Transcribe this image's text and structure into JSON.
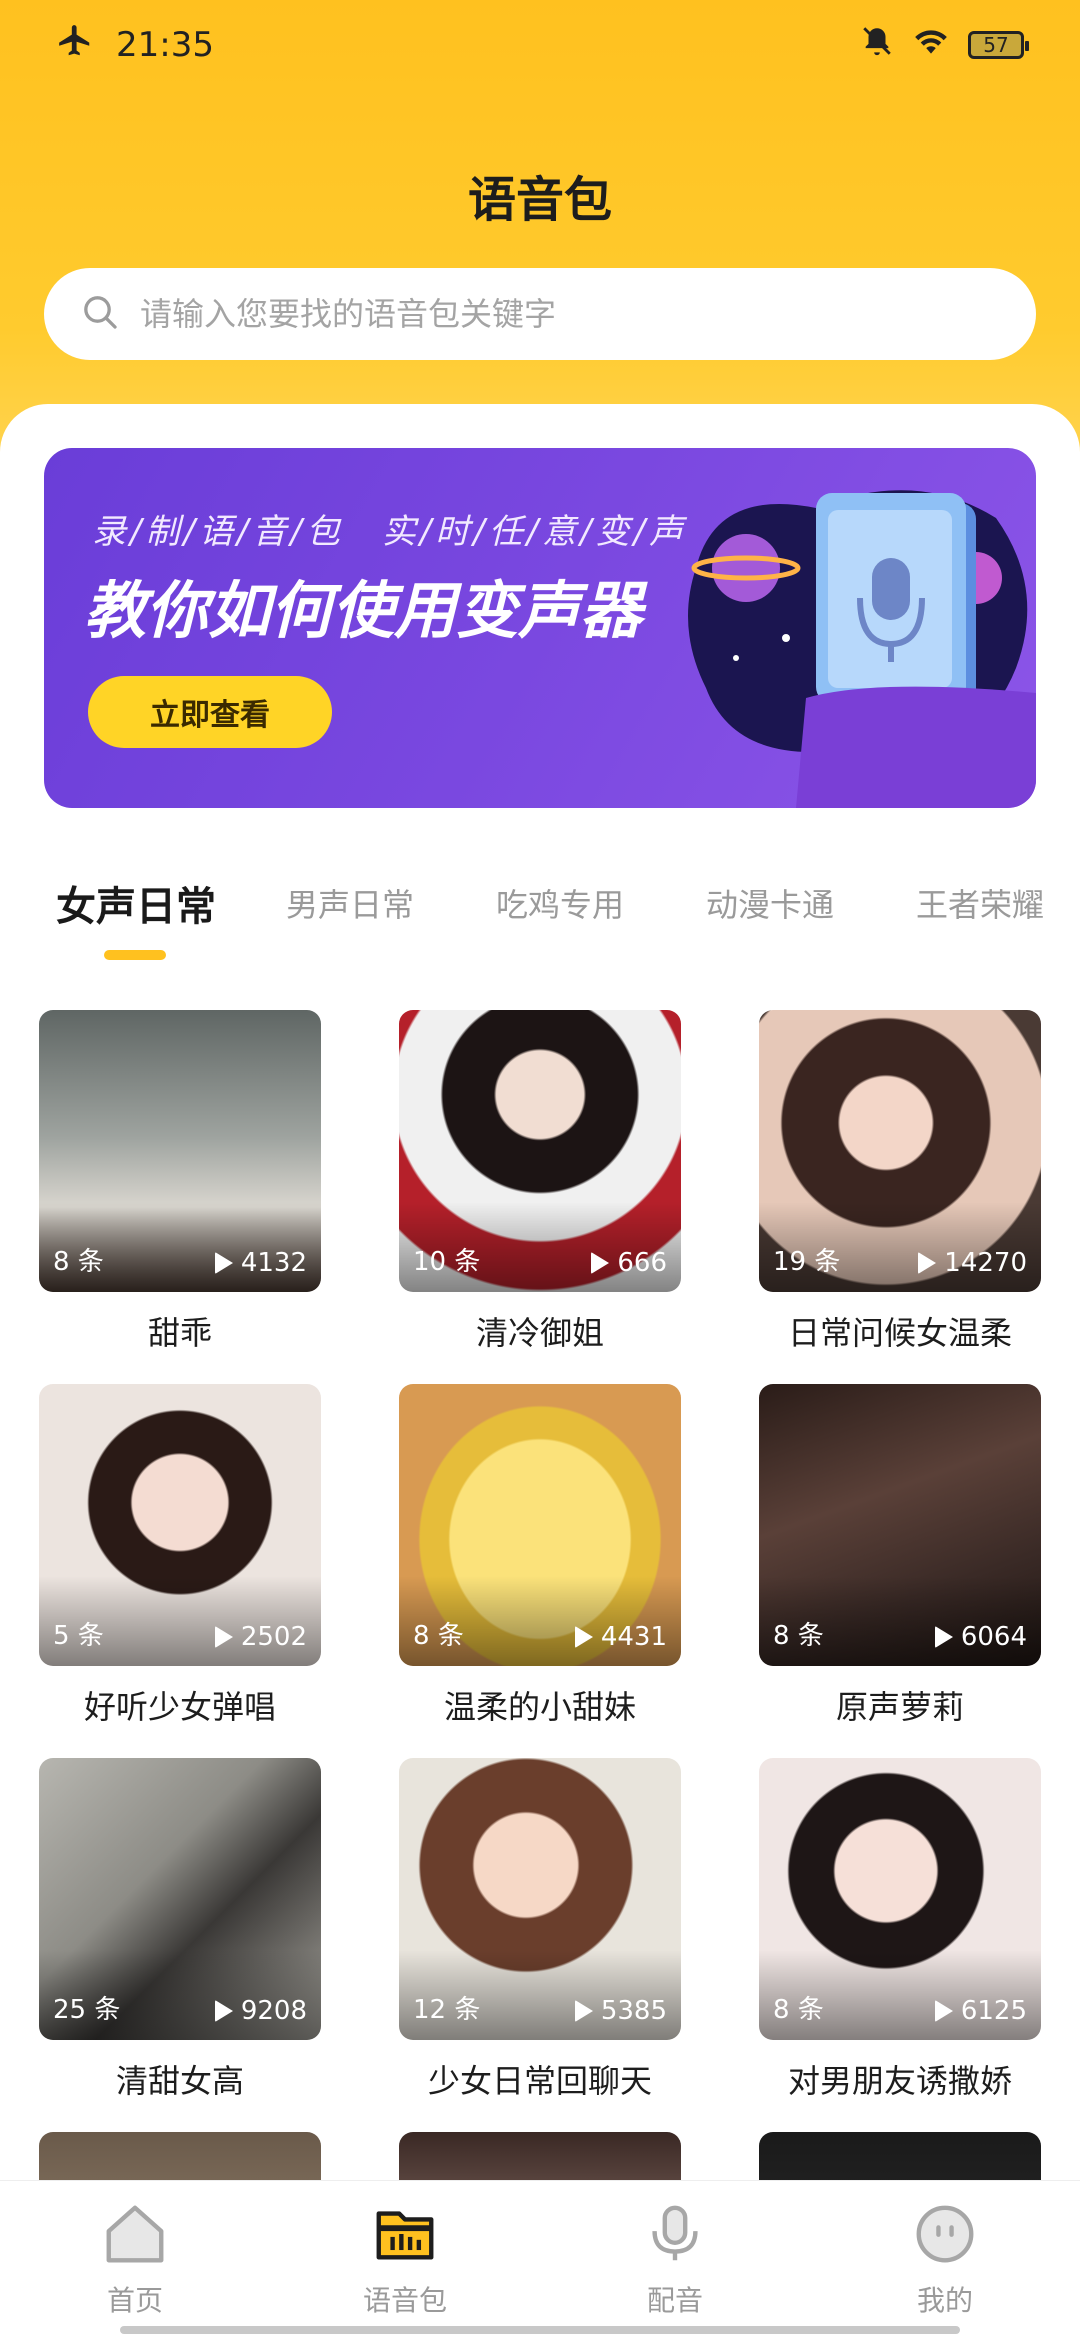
{
  "status_bar": {
    "time": "21:35",
    "battery": "57",
    "icons": [
      "airplane-icon",
      "mute-bell-icon",
      "wifi-icon",
      "battery-icon"
    ]
  },
  "header": {
    "title": "语音包"
  },
  "search": {
    "placeholder": "请输入您要找的语音包关键字",
    "value": ""
  },
  "banner": {
    "subtitle": "录/制/语/音/包　实/时/任/意/变/声",
    "title": "教你如何使用变声器",
    "button_label": "立即查看"
  },
  "tabs": [
    {
      "label": "女声日常",
      "active": true
    },
    {
      "label": "男声日常",
      "active": false
    },
    {
      "label": "吃鸡专用",
      "active": false
    },
    {
      "label": "动漫卡通",
      "active": false
    },
    {
      "label": "王者荣耀",
      "active": false
    }
  ],
  "voice_packs": [
    {
      "title": "甜乖",
      "count": "8 条",
      "plays": "4132",
      "color": "#8a8f8c"
    },
    {
      "title": "清冷御姐",
      "count": "10 条",
      "plays": "666",
      "color": "#3a2a2a"
    },
    {
      "title": "日常问候女温柔",
      "count": "19 条",
      "plays": "14270",
      "color": "#c9a58d"
    },
    {
      "title": "好听少女弹唱",
      "count": "5 条",
      "plays": "2502",
      "color": "#d9c3b6"
    },
    {
      "title": "温柔的小甜妹",
      "count": "8 条",
      "plays": "4431",
      "color": "#e8c94a"
    },
    {
      "title": "原声萝莉",
      "count": "8 条",
      "plays": "6064",
      "color": "#5a4038"
    },
    {
      "title": "清甜女高",
      "count": "25 条",
      "plays": "9208",
      "color": "#8d8c86"
    },
    {
      "title": "少女日常回聊天",
      "count": "12 条",
      "plays": "5385",
      "color": "#b79b86"
    },
    {
      "title": "对男朋友诱撒娇",
      "count": "8 条",
      "plays": "6125",
      "color": "#d7c3c0"
    }
  ],
  "bottom_nav": [
    {
      "label": "首页",
      "icon": "home-icon",
      "active": false
    },
    {
      "label": "语音包",
      "icon": "voice-pack-icon",
      "active": true
    },
    {
      "label": "配音",
      "icon": "microphone-icon",
      "active": false
    },
    {
      "label": "我的",
      "icon": "profile-face-icon",
      "active": false
    }
  ]
}
